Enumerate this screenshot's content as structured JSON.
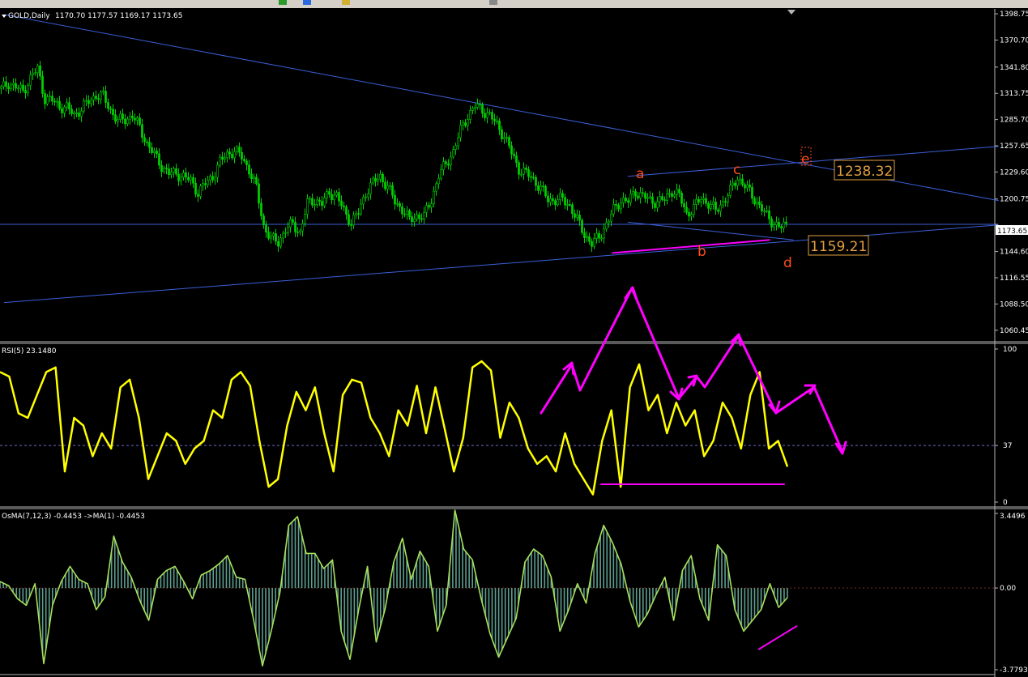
{
  "price_panel": {
    "symbol_label": "GOLD,Daily",
    "ohlc_label": "1170.70 1177.57 1169.17 1173.65",
    "ticks": [
      "1398.75",
      "1370.70",
      "1341.80",
      "1313.75",
      "1285.70",
      "1257.65",
      "1229.60",
      "1200.75",
      "1173.65",
      "1144.60",
      "1116.55",
      "1088.50",
      "1060.45"
    ],
    "current_price": "1173.65",
    "wave_labels": [
      "a",
      "b",
      "c",
      "d",
      "e"
    ],
    "box_labels": [
      "1238.32",
      "1159.21"
    ]
  },
  "rsi_panel": {
    "label": "RSI(5) 23.1480",
    "ticks": [
      "100",
      "37",
      "0"
    ]
  },
  "osma_panel": {
    "label": "OsMA(7,12,3) -0.4453  ->MA(1) -0.4453",
    "ticks": [
      "3.4496",
      "0.00",
      "-3.7793"
    ]
  },
  "colors": {
    "candle": "#00d000",
    "trendline": "#3a5fd8",
    "rsi_line": "#ffff00",
    "osma_line": "#a8e05a",
    "osma_hist": "#5e9e8e",
    "annotation": "#ff00ff",
    "wave_label": "#ff4d1a",
    "price_box": "#e0a040",
    "grid": "#b4b4b4"
  },
  "chart_data": [
    {
      "type": "candlestick",
      "title": "GOLD,Daily",
      "ylim": [
        1049,
        1404
      ],
      "close_path": [
        1318,
        1325,
        1320,
        1316,
        1330,
        1340,
        1308,
        1306,
        1300,
        1298,
        1291,
        1297,
        1305,
        1312,
        1310,
        1296,
        1284,
        1286,
        1290,
        1277,
        1260,
        1248,
        1236,
        1228,
        1228,
        1225,
        1220,
        1208,
        1217,
        1225,
        1240,
        1249,
        1252,
        1246,
        1232,
        1212,
        1172,
        1158,
        1155,
        1168,
        1174,
        1165,
        1196,
        1200,
        1195,
        1208,
        1204,
        1188,
        1176,
        1186,
        1208,
        1218,
        1225,
        1214,
        1198,
        1190,
        1178,
        1183,
        1182,
        1200,
        1226,
        1238,
        1252,
        1274,
        1290,
        1300,
        1296,
        1290,
        1280,
        1268,
        1250,
        1233,
        1228,
        1222,
        1212,
        1200,
        1200,
        1200,
        1194,
        1178,
        1163,
        1153,
        1160,
        1174,
        1189,
        1200,
        1198,
        1209,
        1204,
        1199,
        1198,
        1200,
        1210,
        1204,
        1185,
        1191,
        1202,
        1196,
        1188,
        1198,
        1209,
        1224,
        1215,
        1204,
        1194,
        1182,
        1175,
        1170,
        1173.65
      ],
      "last_ohlc": {
        "open": 1170.7,
        "high": 1177.57,
        "low": 1169.17,
        "close": 1173.65
      },
      "horizontal_line": 1173.65,
      "trendlines": [
        {
          "from": [
            0,
            1398
          ],
          "to": [
            125,
            1199
          ]
        },
        {
          "from": [
            0,
            1090
          ],
          "to": [
            125,
            1173
          ]
        },
        {
          "from": [
            79,
            1225
          ],
          "to": [
            125,
            1257
          ]
        },
        {
          "from": [
            79,
            1176
          ],
          "to": [
            100,
            1157
          ]
        }
      ],
      "wave_labels": [
        {
          "label": "a",
          "x": 79,
          "y": 1232
        },
        {
          "label": "b",
          "x": 87,
          "y": 1152
        },
        {
          "label": "c",
          "x": 91,
          "y": 1235
        },
        {
          "label": "d",
          "x": 98,
          "y": 1139
        },
        {
          "label": "e",
          "x": 101,
          "y": 1252
        }
      ],
      "price_boxes": [
        {
          "text": "1238.32",
          "value": 1238.32
        },
        {
          "text": "1159.21",
          "value": 1159.21
        }
      ],
      "annotations": [
        {
          "type": "segment",
          "color": "#ff00ff",
          "from": [
            77,
            1143
          ],
          "to": [
            97,
            1157
          ]
        }
      ]
    },
    {
      "type": "line",
      "title": "RSI(5) 23.1480",
      "ylim": [
        0,
        100
      ],
      "ticks": [
        0,
        37,
        100
      ],
      "level_line": 37,
      "series": [
        {
          "values": [
            85,
            82,
            58,
            55,
            70,
            85,
            88,
            20,
            55,
            50,
            30,
            45,
            35,
            75,
            80,
            55,
            15,
            30,
            45,
            40,
            25,
            35,
            40,
            60,
            55,
            80,
            85,
            76,
            40,
            10,
            15,
            50,
            72,
            60,
            75,
            45,
            20,
            70,
            80,
            78,
            55,
            45,
            30,
            60,
            50,
            76,
            45,
            75,
            48,
            20,
            42,
            88,
            92,
            86,
            42,
            65,
            55,
            35,
            25,
            30,
            20,
            45,
            25,
            15,
            5,
            40,
            60,
            10,
            75,
            90,
            60,
            70,
            45,
            65,
            50,
            60,
            30,
            40,
            65,
            55,
            35,
            70,
            85,
            35,
            40,
            23.1
          ]
        }
      ]
    },
    {
      "type": "line",
      "title": "OsMA(7,12,3) -0.4453  ->MA(1) -0.4453",
      "ylim": [
        -3.7793,
        3.4496
      ],
      "ticks": [
        3.4496,
        0.0,
        -3.7793
      ],
      "series": [
        {
          "values": [
            0.3,
            0.1,
            -0.5,
            -0.8,
            0.2,
            -3.5,
            -0.8,
            0.3,
            1.0,
            0.4,
            0.2,
            -1.0,
            -0.4,
            2.4,
            1.2,
            0.5,
            -0.6,
            -1.5,
            0.4,
            0.8,
            1.0,
            0.3,
            -0.5,
            0.6,
            0.8,
            1.1,
            1.5,
            0.5,
            0.4,
            -1.5,
            -3.6,
            -2.0,
            -0.2,
            2.9,
            3.3,
            1.6,
            1.6,
            0.9,
            1.3,
            -2.0,
            -3.3,
            -1.0,
            1.0,
            -2.5,
            -1.0,
            1.2,
            2.3,
            0.4,
            1.7,
            1.0,
            -2.0,
            -0.8,
            3.6,
            1.8,
            1.3,
            -0.5,
            -2.1,
            -3.2,
            -2.3,
            -1.4,
            1.2,
            1.8,
            1.5,
            0.5,
            -2.0,
            -1.0,
            0.2,
            -0.7,
            1.6,
            2.9,
            2.1,
            1.1,
            -0.6,
            -1.8,
            -1.2,
            -0.3,
            0.5,
            -1.5,
            0.8,
            1.5,
            -0.5,
            -1.5,
            2.0,
            1.5,
            -1.0,
            -2.0,
            -1.5,
            -1.0,
            0.2,
            -0.9,
            -0.4453
          ]
        }
      ],
      "annotations": [
        {
          "type": "segment",
          "color": "#ff00ff",
          "from": [
            93,
            -2.4
          ],
          "to": [
            98,
            -1.3
          ]
        }
      ]
    }
  ]
}
